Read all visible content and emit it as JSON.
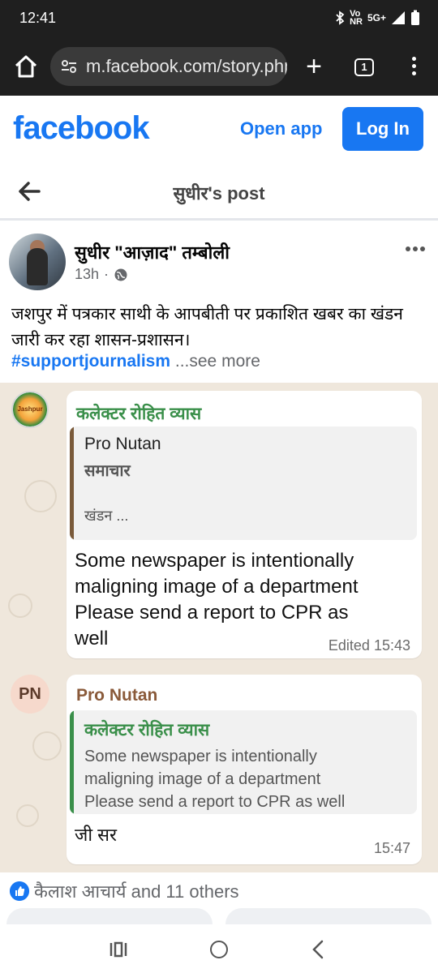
{
  "status_bar": {
    "time": "12:41",
    "network_label": "Vo",
    "network_sub": "NR",
    "signal_label": "5G+"
  },
  "browser": {
    "url": "m.facebook.com/story.php?",
    "tab_count": "1"
  },
  "fb_header": {
    "logo_text": "facebook",
    "open_app_label": "Open app",
    "login_label": "Log In",
    "brand_color": "#1877f2"
  },
  "post_header": {
    "title": "सुधीर's post"
  },
  "post": {
    "author": "सुधीर \"आज़ाद\" तम्बोली",
    "time": "13h",
    "text": "जशपुर में पत्रकार साथी के आपबीती पर प्रकाशित खबर का खंडन जारी कर रहा शासन-प्रशासन।",
    "hashtag": "#supportjournalism",
    "see_more": "...see more"
  },
  "chat": {
    "logo_text": "Jashpur",
    "msg1": {
      "sender": "कलेक्टर रोहित व्यास",
      "quote_name": "Pro Nutan",
      "quote_line1": "समाचार",
      "quote_line2": "खंडन ...",
      "body_line1": "Some newspaper is intentionally",
      "body_line2": "maligning image of a department",
      "body_line3": "Please send a report to CPR as",
      "body_line4": "well",
      "time": "Edited 15:43"
    },
    "msg2": {
      "avatar_initials": "PN",
      "sender": "Pro Nutan",
      "quote_name": "कलेक्टर रोहित व्यास",
      "quote_line1": "Some newspaper is intentionally",
      "quote_line2": "maligning image of a department",
      "quote_line3": "Please send a report to CPR as well",
      "body": "जी सर",
      "time": "15:47"
    }
  },
  "reactions": {
    "text": "कैलाश आचार्य and 11 others"
  },
  "icons": [
    "home-icon",
    "tune-icon",
    "plus-icon",
    "tabs-icon",
    "more-vert-icon",
    "back-arrow-icon",
    "globe-icon",
    "more-horiz-icon",
    "like-icon",
    "recents-icon",
    "nav-home-icon",
    "nav-back-icon"
  ]
}
